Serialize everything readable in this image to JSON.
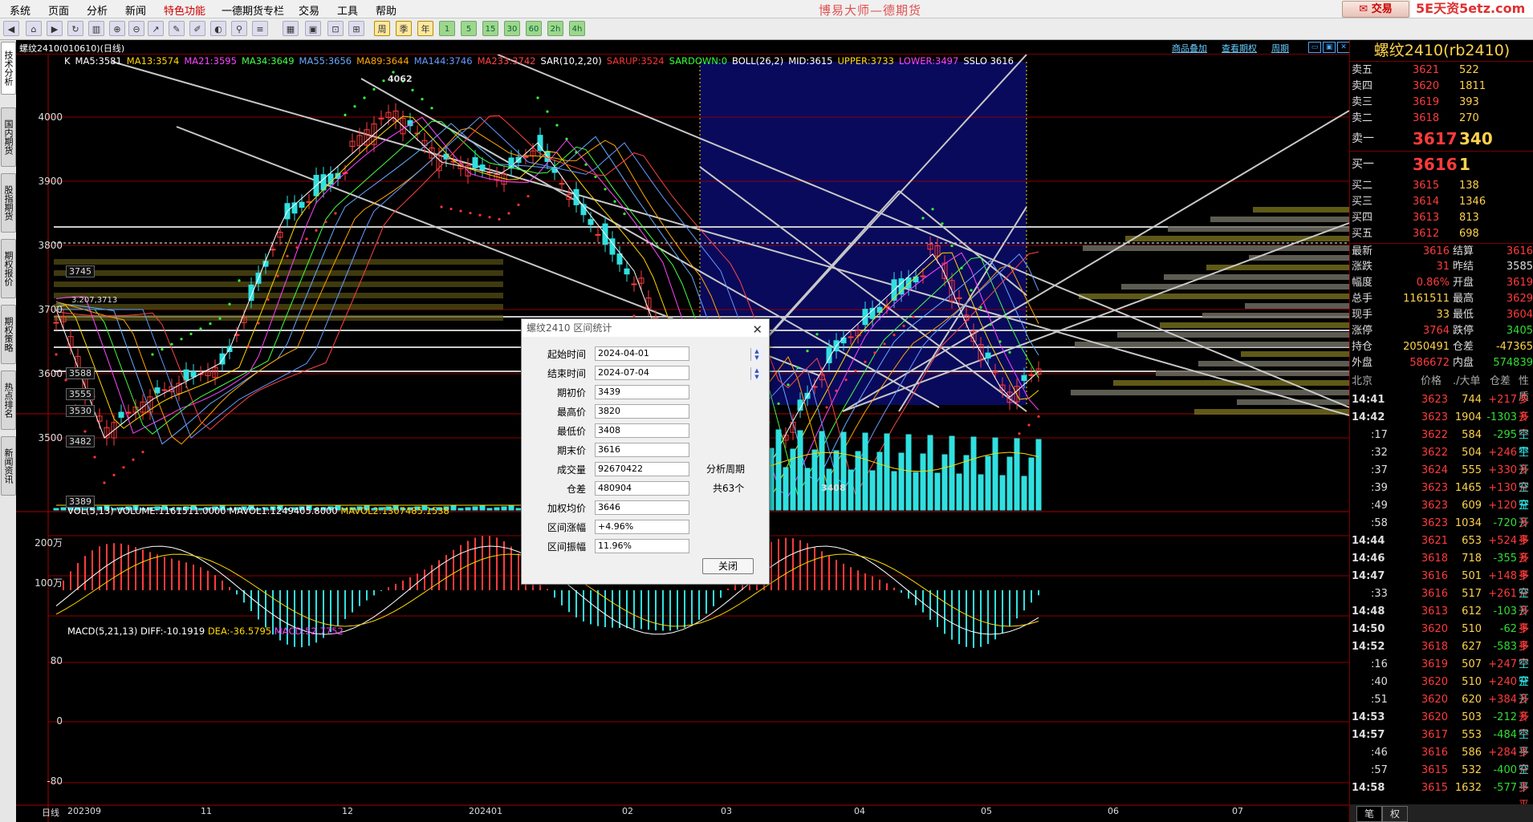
{
  "menu": {
    "items": [
      "系统",
      "页面",
      "分析",
      "新闻",
      "特色功能",
      "一德期货专栏",
      "交易",
      "工具",
      "帮助"
    ],
    "brand": "博易大师—德期货",
    "trade_button": "交易",
    "watermark": "5E天资5etz.com"
  },
  "toolbar": {
    "period_buttons": [
      "周",
      "季",
      "年",
      "1",
      "5",
      "15",
      "30",
      "60",
      "2h",
      "4h"
    ]
  },
  "sidebar_tabs": [
    "技术分析",
    "国内期货",
    "股指期货",
    "期权报价",
    "期权策略",
    "热点排名",
    "新闻资讯"
  ],
  "chart_header": {
    "title": "螺纹2410(010610)(日线)",
    "links": [
      "商品叠加",
      "查看期权",
      "周期"
    ]
  },
  "ma_line": [
    {
      "text": "K",
      "color": "#ffffff"
    },
    {
      "text": "MA5:3581",
      "color": "#ffffff"
    },
    {
      "text": "MA13:3574",
      "color": "#ffd700"
    },
    {
      "text": "MA21:3595",
      "color": "#ff44ff"
    },
    {
      "text": "MA34:3649",
      "color": "#44ff44"
    },
    {
      "text": "MA55:3656",
      "color": "#66aaff"
    },
    {
      "text": "MA89:3644",
      "color": "#ffa500"
    },
    {
      "text": "MA144:3746",
      "color": "#6699ff"
    },
    {
      "text": "MA233:3742",
      "color": "#ff4444"
    },
    {
      "text": "SAR(10,2,20)",
      "color": "#ffffff"
    },
    {
      "text": "SARUP:3524",
      "color": "#ff3333"
    },
    {
      "text": "SARDOWN:0",
      "color": "#33ff33"
    },
    {
      "text": "BOLL(26,2)",
      "color": "#ffffff"
    },
    {
      "text": "MID:3615",
      "color": "#ffffff"
    },
    {
      "text": "UPPER:3733",
      "color": "#ffd700"
    },
    {
      "text": "LOWER:3497",
      "color": "#ff44ff"
    },
    {
      "text": "SSLO 3616",
      "color": "#ffffff"
    }
  ],
  "price_axis": [
    "4000",
    "3900",
    "3800",
    "3700",
    "3600",
    "3500"
  ],
  "price_markers": [
    "3745",
    "3588",
    "3555",
    "3530",
    "3482",
    "3389"
  ],
  "annotations": {
    "high": "4062",
    "low": "3408",
    "dotted": "3.207,3713"
  },
  "volume_line": {
    "label": "VOL(5,13) VOLUME:1161511.0000",
    "mavol1": "MAVOL1:1249405.8000",
    "mavol2": "MAVOL2:1307485.1538",
    "axis": [
      "200万",
      "100万"
    ]
  },
  "macd_line": {
    "label": "MACD(5,21,13)",
    "diff": "DIFF:-10.1919",
    "dea": "DEA:-36.5795",
    "macd": "MACD:52.7752",
    "axis": [
      "80",
      "0",
      "-80"
    ]
  },
  "x_axis": [
    "日线",
    "202309",
    "11",
    "12",
    "202401",
    "02",
    "03",
    "04",
    "05",
    "06",
    "07"
  ],
  "dialog": {
    "title": "螺纹2410 区间统计",
    "rows": [
      {
        "label": "起始时间",
        "value": "2024-04-01"
      },
      {
        "label": "结束时间",
        "value": "2024-07-04"
      },
      {
        "label": "期初价",
        "value": "3439"
      },
      {
        "label": "最高价",
        "value": "3820"
      },
      {
        "label": "最低价",
        "value": "3408"
      },
      {
        "label": "期末价",
        "value": "3616"
      },
      {
        "label": "成交量",
        "value": "92670422"
      },
      {
        "label": "仓差",
        "value": "480904"
      },
      {
        "label": "加权均价",
        "value": "3646"
      },
      {
        "label": "区间涨幅",
        "value": "+4.96%"
      },
      {
        "label": "区间振幅",
        "value": "11.96%"
      }
    ],
    "period_label": "分析周期",
    "period_value": "共63个",
    "close_button": "关闭"
  },
  "right_panel": {
    "title": "螺纹2410(rb2410)",
    "asks": [
      {
        "label": "卖五",
        "price": "3621",
        "vol": "522"
      },
      {
        "label": "卖四",
        "price": "3620",
        "vol": "1811"
      },
      {
        "label": "卖三",
        "price": "3619",
        "vol": "393"
      },
      {
        "label": "卖二",
        "price": "3618",
        "vol": "270"
      }
    ],
    "ask1": {
      "label": "卖一",
      "price": "3617",
      "vol": "340"
    },
    "bid1": {
      "label": "买一",
      "price": "3616",
      "vol": "1"
    },
    "bids": [
      {
        "label": "买二",
        "price": "3615",
        "vol": "138"
      },
      {
        "label": "买三",
        "price": "3614",
        "vol": "1346"
      },
      {
        "label": "买四",
        "price": "3613",
        "vol": "813"
      },
      {
        "label": "买五",
        "price": "3612",
        "vol": "698"
      }
    ],
    "quote": [
      {
        "a": "最新",
        "b": "3616",
        "bc": "#ff3b3b",
        "c": "结算",
        "d": "3616",
        "dc": "#ff3b3b"
      },
      {
        "a": "涨跌",
        "b": "31",
        "bc": "#ff3b3b",
        "c": "昨结",
        "d": "3585",
        "dc": "#ddd"
      },
      {
        "a": "幅度",
        "b": "0.86%",
        "bc": "#ff3b3b",
        "c": "开盘",
        "d": "3619",
        "dc": "#ff3b3b"
      },
      {
        "a": "总手",
        "b": "1161511",
        "bc": "#ffd24a",
        "c": "最高",
        "d": "3629",
        "dc": "#ff3b3b"
      },
      {
        "a": "现手",
        "b": "33",
        "bc": "#ffd24a",
        "c": "最低",
        "d": "3604",
        "dc": "#ff3b3b"
      },
      {
        "a": "涨停",
        "b": "3764",
        "bc": "#ff3b3b",
        "c": "跌停",
        "d": "3405",
        "dc": "#33dd33"
      },
      {
        "a": "持仓",
        "b": "2050491",
        "bc": "#ffd24a",
        "c": "仓差",
        "d": "-47365",
        "dc": "#ffd24a"
      },
      {
        "a": "外盘",
        "b": "586672",
        "bc": "#ff3b3b",
        "c": "内盘",
        "d": "574839",
        "dc": "#33dd33"
      }
    ],
    "ticks_header": [
      "北京",
      "价格",
      "./大单",
      "仓差",
      "性质"
    ],
    "ticks": [
      {
        "t": "14:41",
        "sub": false,
        "p": "3623",
        "v": "744",
        "o": "+217",
        "oc": "#ff3b3b",
        "n": "多开",
        "k": false
      },
      {
        "t": "14:42",
        "sub": false,
        "p": "3623",
        "v": "1904",
        "o": "-1303",
        "oc": "#33dd33",
        "n": "多平",
        "k": false
      },
      {
        "t": ":17",
        "sub": true,
        "p": "3622",
        "v": "584",
        "o": "-295",
        "oc": "#33dd33",
        "n": "空平",
        "k": true
      },
      {
        "t": ":32",
        "sub": true,
        "p": "3622",
        "v": "504",
        "o": "+246",
        "oc": "#ff3b3b",
        "n": "空开",
        "k": true
      },
      {
        "t": ":37",
        "sub": true,
        "p": "3624",
        "v": "555",
        "o": "+330",
        "oc": "#ff3b3b",
        "n": "多开",
        "k": false
      },
      {
        "t": ":39",
        "sub": true,
        "p": "3623",
        "v": "1465",
        "o": "+130",
        "oc": "#ff3b3b",
        "n": "空开",
        "k": true
      },
      {
        "t": ":49",
        "sub": true,
        "p": "3623",
        "v": "609",
        "o": "+120",
        "oc": "#ff3b3b",
        "n": "空开",
        "k": true
      },
      {
        "t": ":58",
        "sub": true,
        "p": "3623",
        "v": "1034",
        "o": "-720",
        "oc": "#33dd33",
        "n": "多平",
        "k": false
      },
      {
        "t": "14:44",
        "sub": false,
        "p": "3621",
        "v": "653",
        "o": "+524",
        "oc": "#ff3b3b",
        "n": "多开",
        "k": false
      },
      {
        "t": "14:46",
        "sub": false,
        "p": "3618",
        "v": "718",
        "o": "-355",
        "oc": "#33dd33",
        "n": "多平",
        "k": false
      },
      {
        "t": "14:47",
        "sub": false,
        "p": "3616",
        "v": "501",
        "o": "+148",
        "oc": "#ff3b3b",
        "n": "多开",
        "k": false
      },
      {
        "t": ":33",
        "sub": true,
        "p": "3616",
        "v": "517",
        "o": "+261",
        "oc": "#ff3b3b",
        "n": "空开",
        "k": true
      },
      {
        "t": "14:48",
        "sub": false,
        "p": "3613",
        "v": "612",
        "o": "-103",
        "oc": "#33dd33",
        "n": "多平",
        "k": false
      },
      {
        "t": "14:50",
        "sub": false,
        "p": "3620",
        "v": "510",
        "o": "-62",
        "oc": "#33dd33",
        "n": "多平",
        "k": false
      },
      {
        "t": "14:52",
        "sub": false,
        "p": "3618",
        "v": "627",
        "o": "-583",
        "oc": "#33dd33",
        "n": "多平",
        "k": false
      },
      {
        "t": ":16",
        "sub": true,
        "p": "3619",
        "v": "507",
        "o": "+247",
        "oc": "#ff3b3b",
        "n": "空开",
        "k": true
      },
      {
        "t": ":40",
        "sub": true,
        "p": "3620",
        "v": "510",
        "o": "+240",
        "oc": "#ff3b3b",
        "n": "空开",
        "k": true
      },
      {
        "t": ":51",
        "sub": true,
        "p": "3620",
        "v": "620",
        "o": "+384",
        "oc": "#ff3b3b",
        "n": "多开",
        "k": false
      },
      {
        "t": "14:53",
        "sub": false,
        "p": "3620",
        "v": "503",
        "o": "-212",
        "oc": "#33dd33",
        "n": "多平",
        "k": false
      },
      {
        "t": "14:57",
        "sub": false,
        "p": "3617",
        "v": "553",
        "o": "-484",
        "oc": "#33dd33",
        "n": "空平",
        "k": true
      },
      {
        "t": ":46",
        "sub": true,
        "p": "3616",
        "v": "586",
        "o": "+284",
        "oc": "#ff3b3b",
        "n": "多开",
        "k": false
      },
      {
        "t": ":57",
        "sub": true,
        "p": "3615",
        "v": "532",
        "o": "-400",
        "oc": "#33dd33",
        "n": "空平",
        "k": true
      },
      {
        "t": "14:58",
        "sub": false,
        "p": "3615",
        "v": "1632",
        "o": "-577",
        "oc": "#33dd33",
        "n": "多平",
        "k": false
      }
    ],
    "bottom_tabs": [
      "笔",
      "权"
    ]
  },
  "colors": {
    "up": "#ff3b3b",
    "down": "#30e0e0",
    "grid": "#8b0000",
    "highlight": "#0a0a5c"
  }
}
